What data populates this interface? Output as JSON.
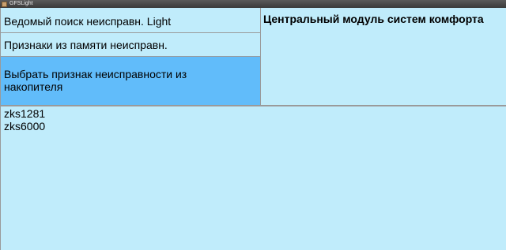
{
  "window": {
    "title": "GFSLight"
  },
  "menu": {
    "items": [
      {
        "label": "Ведомый поиск неисправн. Light"
      },
      {
        "label": "Признаки из памяти неисправн."
      },
      {
        "label": "Выбрать признак неисправности из накопителя",
        "selected": true
      }
    ]
  },
  "module_panel": {
    "title": "Центральный модуль систем комфорта"
  },
  "fault_list": {
    "items": [
      "zks1281",
      "zks6000"
    ]
  },
  "colors": {
    "background": "#c0ecfb",
    "selected": "#61bcfa",
    "border": "#9a9a9a"
  }
}
